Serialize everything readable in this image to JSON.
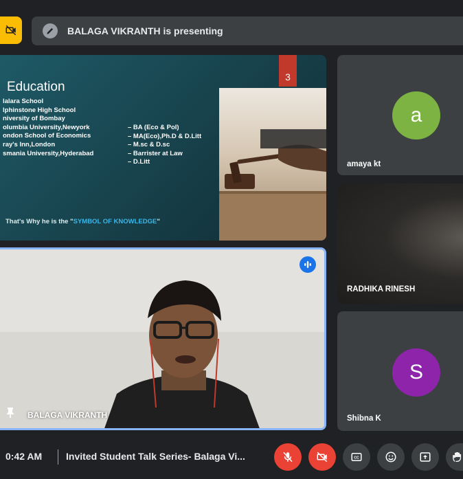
{
  "presenting_banner": {
    "text": "BALAGA VIKRANTH is presenting"
  },
  "slide": {
    "number": "3",
    "title": "Education",
    "schools": [
      "lalara School",
      "lphinstone High School",
      "niversity of Bombay",
      "olumbia University,Newyork",
      "ondon School of Economics",
      "ray's Inn,London",
      "smania University,Hyderabad"
    ],
    "degrees": [
      "– BA (Eco & Pol)",
      "– MA(Eco),Ph.D & D.Litt",
      "– M.sc & D.sc",
      "– Barrister at Law",
      "– D.Litt"
    ],
    "quote_prefix": "That's Why he is the \"",
    "quote_highlight": "SYMBOL OF KNOWLEDGE",
    "quote_suffix": "\""
  },
  "presenter_tile": {
    "name": "BALAGA VIKRANTH"
  },
  "participants": [
    {
      "name": "amaya kt",
      "initial": "a",
      "avatar_color": "#7cb342"
    },
    {
      "name": "RADHIKA RINESH"
    },
    {
      "name": "Shibna K",
      "initial": "S",
      "avatar_color": "#8e24aa"
    }
  ],
  "bottom_bar": {
    "time": "0:42 AM",
    "meeting_title": "Invited Student Talk Series- Balaga Vi..."
  },
  "colors": {
    "danger": "#ea4335",
    "accent": "#1a73e8",
    "warning": "#fbbc04",
    "tile": "#3c4043"
  }
}
